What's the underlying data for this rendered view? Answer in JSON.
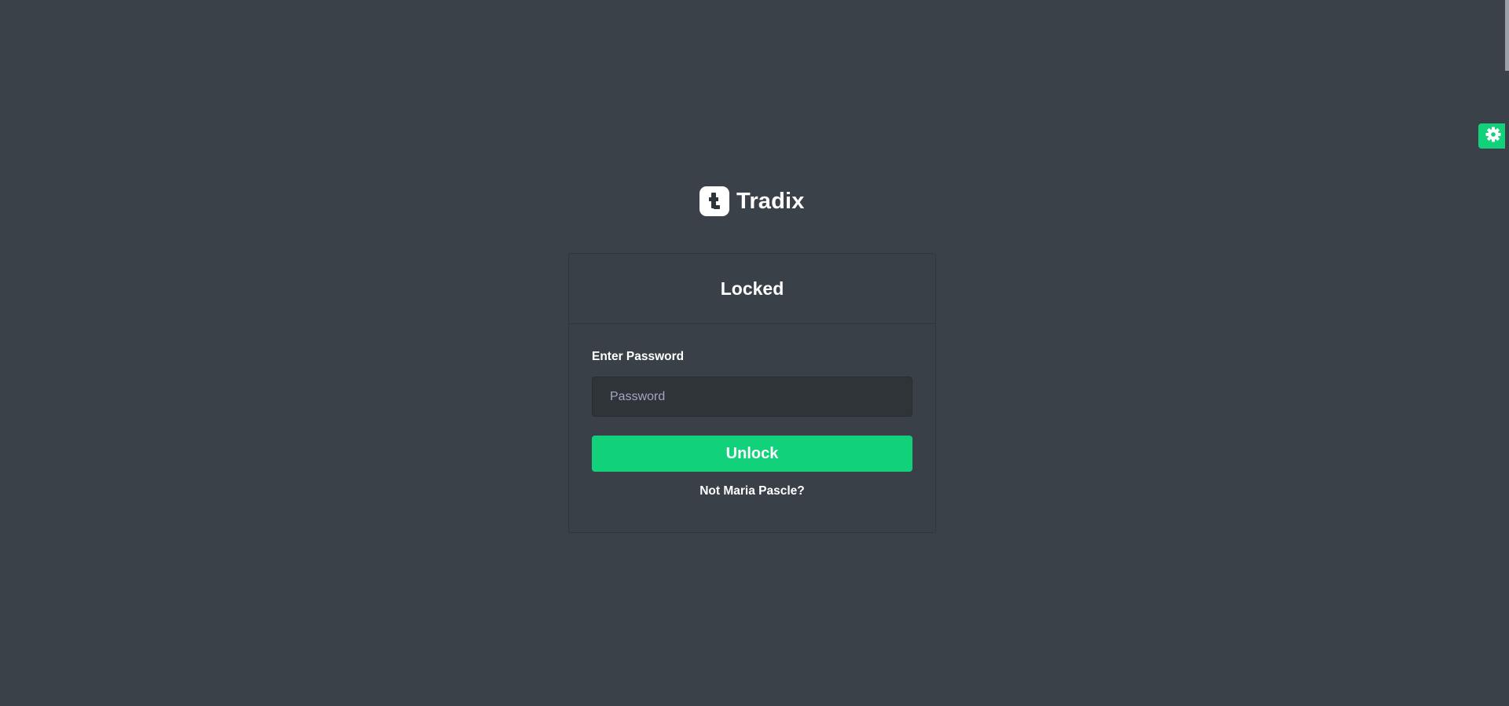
{
  "brand": {
    "name": "Tradix",
    "logo_icon": "tradix-logo-icon"
  },
  "lock_card": {
    "title": "Locked",
    "password_label": "Enter Password",
    "password_placeholder": "Password",
    "password_value": "",
    "unlock_label": "Unlock",
    "not_user_link": "Not Maria Pascle?"
  },
  "settings": {
    "icon": "gear-icon"
  },
  "colors": {
    "background": "#3a4148",
    "accent": "#12d17b",
    "input_background": "#2e3438"
  }
}
